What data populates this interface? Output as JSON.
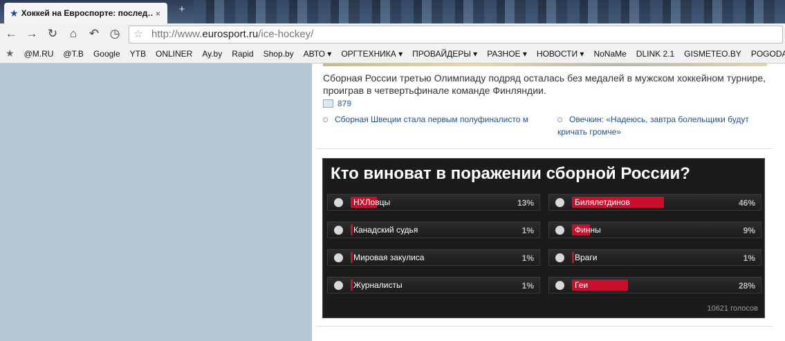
{
  "tab": {
    "title": "Хоккей на Евроспорте: послед…",
    "close": "×"
  },
  "new_tab": "+",
  "toolbar": {
    "back": "←",
    "forward": "→",
    "reload": "↻",
    "home": "⌂",
    "undo": "↶",
    "history": "◷",
    "url_prefix": "http://www.",
    "url_domain": "eurosport.ru",
    "url_path": "/ice-hockey/"
  },
  "bookmarks": [
    "@M.RU",
    "@T.B",
    "Google",
    "YTB",
    "ONLINER",
    "Ay.by",
    "Rapid",
    "Shop.by",
    "АВТО ▾",
    "ОРГТЕХНИКА ▾",
    "ПРОВАЙДЕРЫ ▾",
    "РАЗНОЕ ▾",
    "НОВОСТИ ▾",
    "NoNaMe",
    "DLINK 2.1",
    "GISMETEO.BY",
    "POGODA"
  ],
  "article": {
    "lead": "Сборная России третью Олимпиаду подряд осталась без медалей в мужском хоккейном турнире, проиграв в четвертьфинале команде Финляндии.",
    "comment_count": "879",
    "related": [
      "Сборная Швеции стала первым полуфиналисто м",
      "Овечкин: «Надеюсь, завтра болельщики будут кричать громче»"
    ]
  },
  "poll": {
    "title": "Кто виноват в поражении сборной России?",
    "accent_color": "#c8102e",
    "options": [
      {
        "label": "НХЛовцы",
        "percent": "13%",
        "value": 13
      },
      {
        "label": "Билялетдинов",
        "percent": "46%",
        "value": 46
      },
      {
        "label": "Канадский судья",
        "percent": "1%",
        "value": 1
      },
      {
        "label": "Финны",
        "percent": "9%",
        "value": 9
      },
      {
        "label": "Мировая закулиса",
        "percent": "1%",
        "value": 1
      },
      {
        "label": "Враги",
        "percent": "1%",
        "value": 1
      },
      {
        "label": "Журналисты",
        "percent": "1%",
        "value": 1
      },
      {
        "label": "Геи",
        "percent": "28%",
        "value": 28
      }
    ],
    "votes": "10621 голосов"
  }
}
